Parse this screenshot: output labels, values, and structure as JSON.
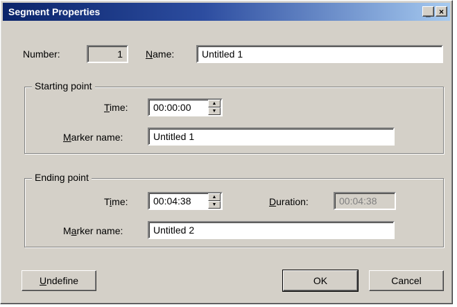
{
  "window": {
    "title": "Segment Properties",
    "minimize_glyph": "_",
    "close_glyph": "×"
  },
  "number": {
    "label": "Number:",
    "value": "1"
  },
  "name": {
    "label_ul": "N",
    "label_rest": "ame:",
    "value": "Untitled 1"
  },
  "starting_point": {
    "legend": "Starting point",
    "time_label_ul": "T",
    "time_label_rest": "ime:",
    "time_value": "00:00:00",
    "marker_label_ul": "M",
    "marker_label_rest": "arker name:",
    "marker_value": "Untitled 1"
  },
  "ending_point": {
    "legend": "Ending point",
    "time_label_pre": "T",
    "time_label_ul": "i",
    "time_label_rest": "me:",
    "time_value": "00:04:38",
    "duration_label_ul": "D",
    "duration_label_rest": "uration:",
    "duration_value": "00:04:38",
    "marker_label_pre": "M",
    "marker_label_ul": "a",
    "marker_label_rest": "rker name:",
    "marker_value": "Untitled 2"
  },
  "buttons": {
    "undefine_ul": "U",
    "undefine_rest": "ndefine",
    "ok": "OK",
    "cancel": "Cancel"
  },
  "icons": {
    "spin_up": "▲",
    "spin_down": "▼"
  }
}
